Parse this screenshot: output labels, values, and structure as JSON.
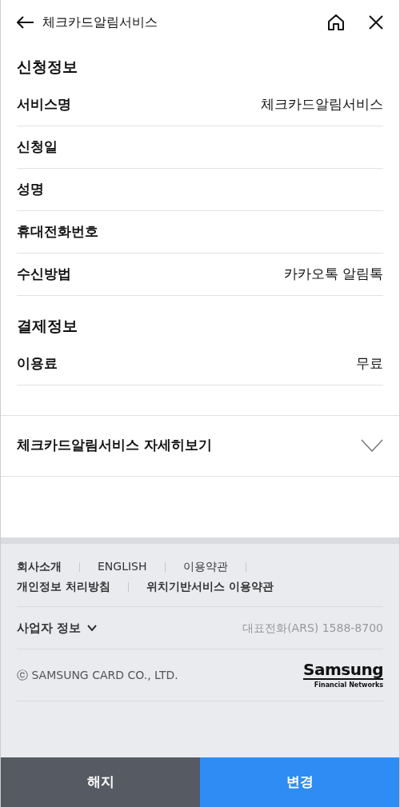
{
  "header": {
    "title": "체크카드알림서비스"
  },
  "sections": [
    {
      "title": "신청정보",
      "rows": [
        {
          "label": "서비스명",
          "value": "체크카드알림서비스"
        },
        {
          "label": "신청일"
        },
        {
          "label": "성명"
        },
        {
          "label": "휴대전화번호"
        },
        {
          "label": "수신방법",
          "value": "카카오톡 알림톡"
        }
      ]
    },
    {
      "title": "결제정보",
      "rows": [
        {
          "label": "이용료",
          "value": "무료"
        }
      ]
    }
  ],
  "details": {
    "label": "체크카드알림서비스 자세히보기",
    "expanded": false
  },
  "footer": {
    "link_rows": [
      [
        {
          "label": "회사소개",
          "emphasis": true
        },
        {
          "label": "ENGLISH",
          "emphasis": false
        },
        {
          "label": "이용약관",
          "emphasis": false
        }
      ],
      [
        {
          "label": "개인정보 처리방침",
          "emphasis": true
        },
        {
          "label": "위치기반서비스 이용약관",
          "emphasis": true
        }
      ]
    ],
    "business_info": {
      "label": "사업자 정보",
      "expanded": false
    },
    "phone": "대표전화(ARS) 1588-8700",
    "copyright": "SAMSUNG CARD CO., LTD.",
    "copyright_mark": "ⓒ",
    "logo": {
      "name": "Samsung",
      "tagline": "Financial Networks"
    }
  },
  "buttons": [
    {
      "label": "해지",
      "kind": "secondary"
    },
    {
      "label": "변경",
      "kind": "primary"
    }
  ]
}
